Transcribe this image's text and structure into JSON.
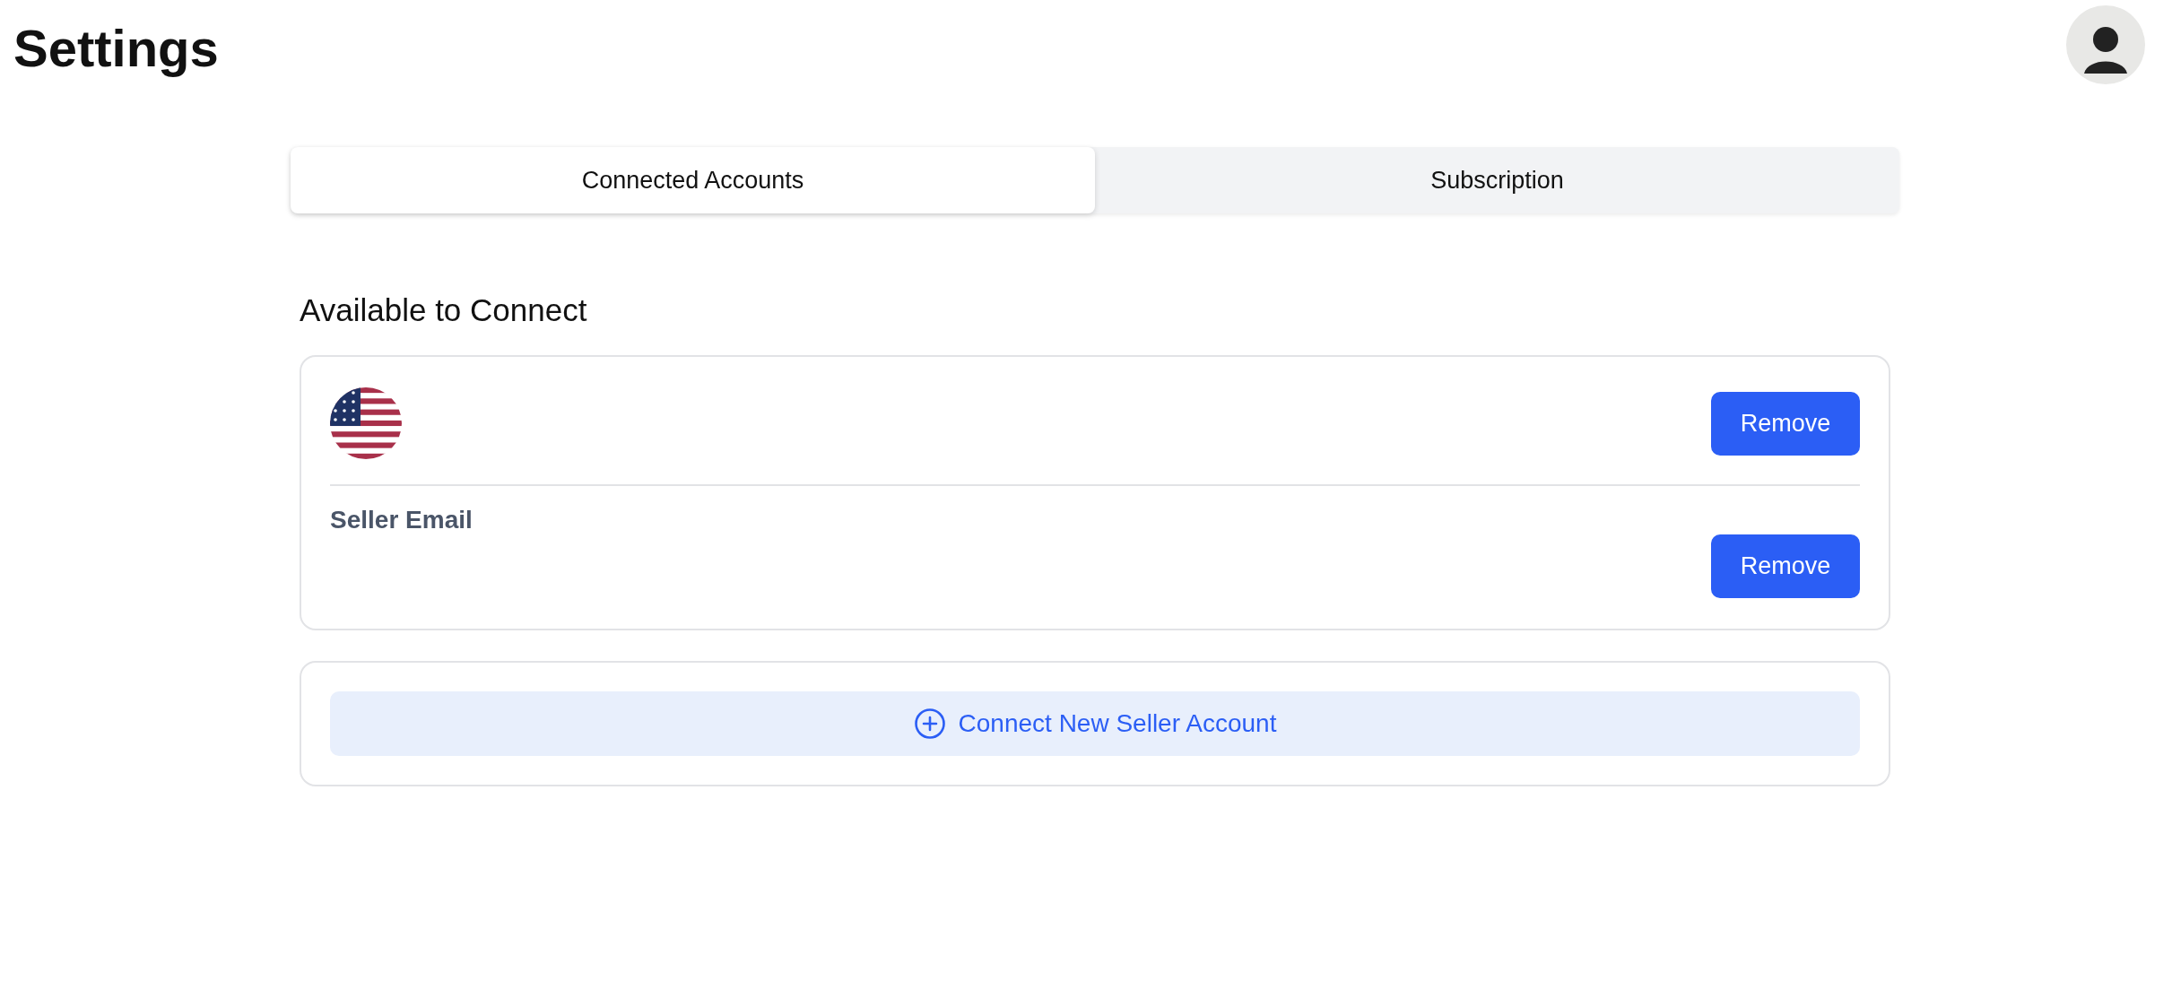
{
  "page": {
    "title": "Settings"
  },
  "tabs": [
    {
      "label": "Connected Accounts",
      "selected": true
    },
    {
      "label": "Subscription",
      "selected": false
    }
  ],
  "section": {
    "heading": "Available to Connect"
  },
  "account_card": {
    "top_button": "Remove",
    "field_label": "Seller Email",
    "bottom_button": "Remove"
  },
  "connect_button": {
    "label": "Connect New Seller Account"
  }
}
